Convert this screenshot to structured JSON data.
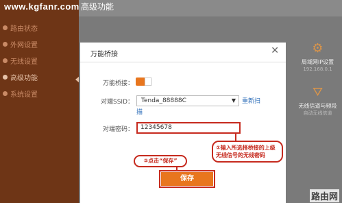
{
  "watermark": "www.kgfanr.com",
  "page_heading": "高级功能",
  "sidebar": {
    "items": [
      {
        "label": "路由状态"
      },
      {
        "label": "外网设置"
      },
      {
        "label": "无线设置"
      },
      {
        "label": "高级功能",
        "active": true
      },
      {
        "label": "系统设置"
      }
    ]
  },
  "right_panel": {
    "items": [
      {
        "label": "局域网IP设置",
        "sub": "192.168.0.1"
      },
      {
        "label": "无线信道与频段",
        "sub": "自动无线信道"
      }
    ]
  },
  "dialog": {
    "title": "万能桥接",
    "close_glyph": "✕",
    "bridge_label": "万能桥接：",
    "bridge_enabled": true,
    "ssid_label": "对端SSID：",
    "ssid_value": "Tenda_88888C",
    "rescan_label_1": "重新扫",
    "rescan_label_2": "描",
    "password_label": "对端密码：",
    "password_value": "12345678",
    "save_label": "保存"
  },
  "annotations": {
    "note1": "①输入所选择桥接的上级无线信号的无线密码",
    "note2": "②点击“保存”"
  },
  "brand_text": "路由网",
  "colors": {
    "accent": "#e8761e",
    "annotation_red": "#c62a1e",
    "sidebar": "#6e3516"
  }
}
